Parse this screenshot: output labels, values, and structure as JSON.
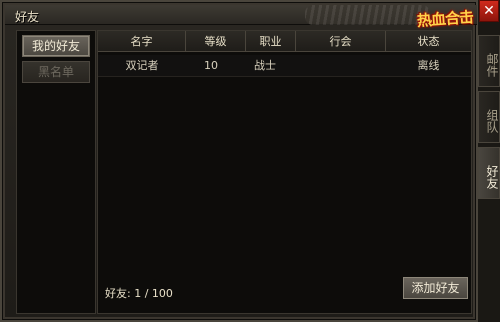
{
  "window": {
    "title": "好友",
    "logo_text": "热血合击",
    "close_glyph": "✕"
  },
  "sidebar": {
    "tabs": [
      {
        "label": "我的好友"
      },
      {
        "label": "黑名单"
      }
    ]
  },
  "table": {
    "headers": [
      "名字",
      "等级",
      "职业",
      "行会",
      "状态"
    ],
    "rows": [
      [
        "双记者",
        "10",
        "战士",
        "",
        "离线"
      ]
    ]
  },
  "footer": {
    "count_label": "好友:",
    "count_value": "1 / 100",
    "add_button": "添加好友"
  },
  "side_tabs": [
    {
      "label": "邮件"
    },
    {
      "label": "组队"
    },
    {
      "label": "好友"
    }
  ]
}
